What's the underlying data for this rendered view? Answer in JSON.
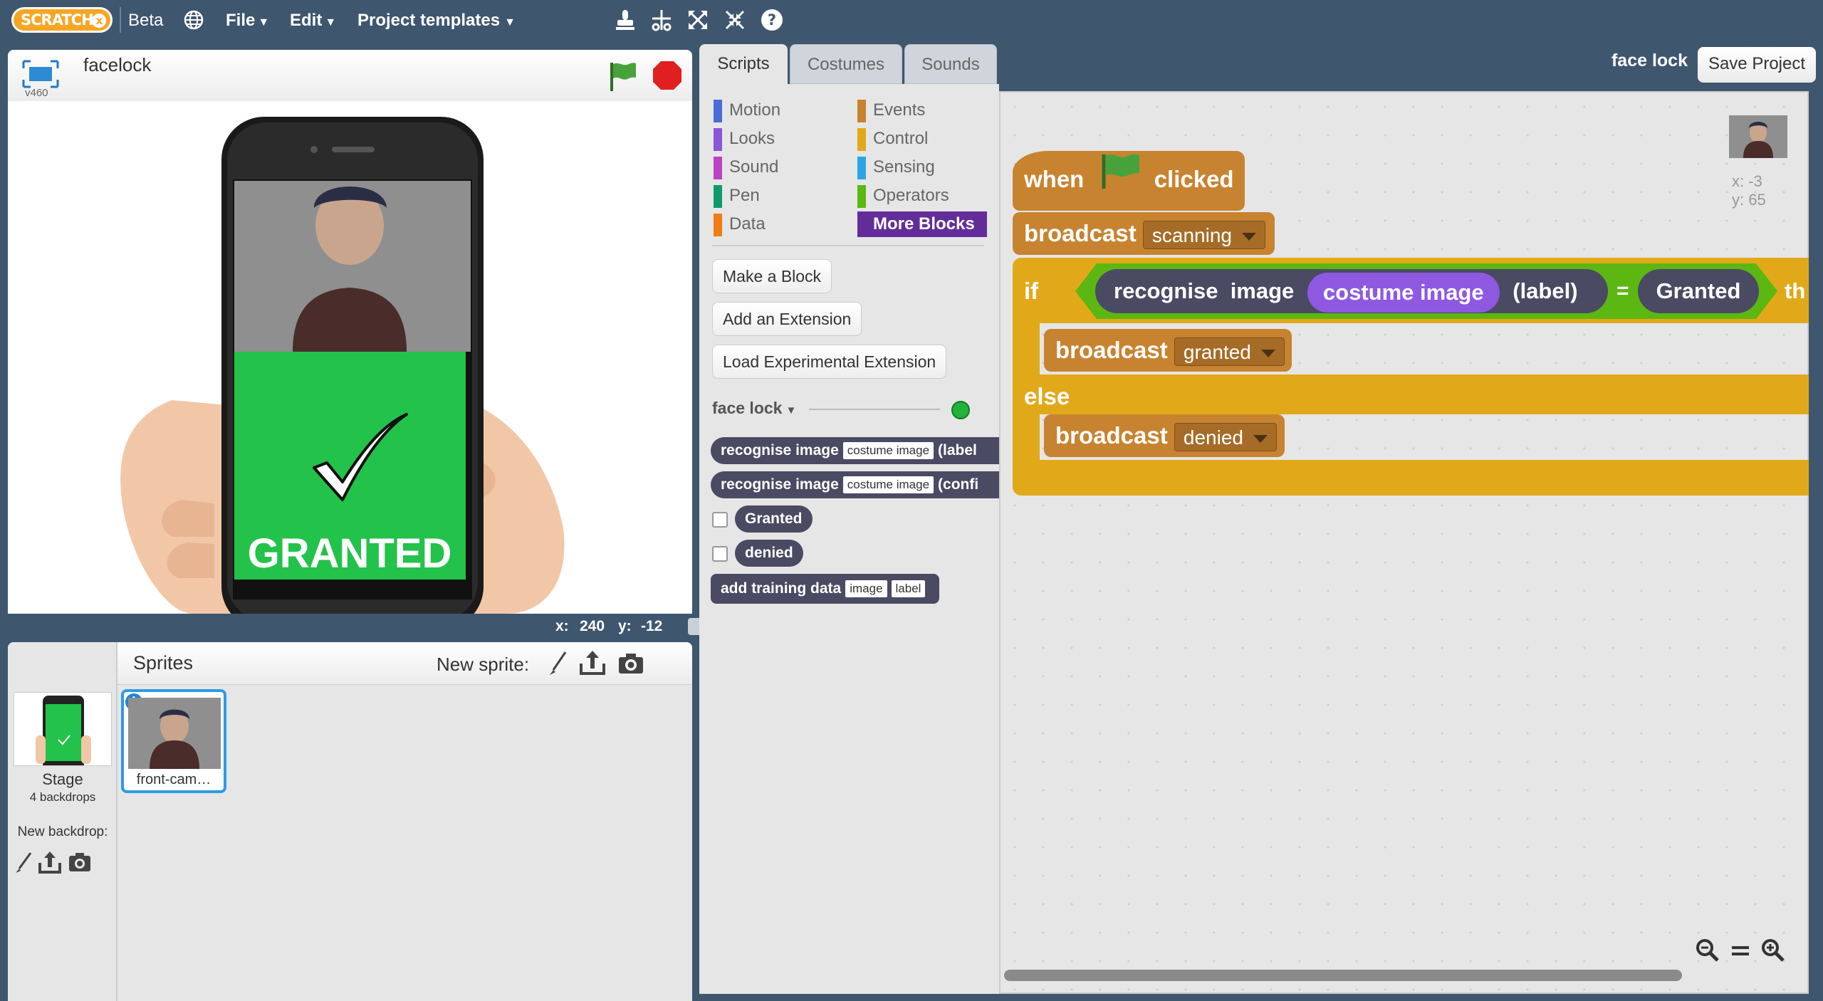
{
  "topbar": {
    "logo": "SCRATCH",
    "logo_x": "x",
    "beta": "Beta",
    "menu_file": "File",
    "menu_edit": "Edit",
    "menu_templates": "Project templates"
  },
  "stage": {
    "project_title": "facelock",
    "version": "v460",
    "screen_text": "GRANTED",
    "mouse_x_label": "x:",
    "mouse_x": "240",
    "mouse_y_label": "y:",
    "mouse_y": "-12"
  },
  "sprites": {
    "header": "Sprites",
    "new_sprite": "New sprite:",
    "stage_label": "Stage",
    "stage_backdrops": "4 backdrops",
    "new_backdrop": "New backdrop:",
    "sprite_name": "front-cam…"
  },
  "tabs": {
    "scripts": "Scripts",
    "costumes": "Costumes",
    "sounds": "Sounds"
  },
  "header_right": {
    "project_name": "face lock",
    "save": "Save Project"
  },
  "categories": {
    "motion": "Motion",
    "looks": "Looks",
    "sound": "Sound",
    "pen": "Pen",
    "data": "Data",
    "events": "Events",
    "control": "Control",
    "sensing": "Sensing",
    "operators": "Operators",
    "more_blocks": "More Blocks"
  },
  "palette": {
    "make_block": "Make a Block",
    "add_extension": "Add an Extension",
    "load_experimental": "Load Experimental Extension",
    "extension_name": "face lock",
    "recognise1_a": "recognise",
    "recognise1_b": "image",
    "recognise1_slot": "costume image",
    "recognise1_end": "(label",
    "recognise2_a": "recognise",
    "recognise2_b": "image",
    "recognise2_slot": "costume image",
    "recognise2_end": "(confi",
    "granted": "Granted",
    "denied": "denied",
    "add_training_a": "add",
    "add_training_b": "training",
    "add_training_c": "data",
    "add_training_slot1": "image",
    "add_training_slot2": "label"
  },
  "script": {
    "when": "when",
    "clicked": "clicked",
    "broadcast": "broadcast",
    "msg_scanning": "scanning",
    "if": "if",
    "recognise": "recognise",
    "image": "image",
    "costume_image": "costume image",
    "label": "(label)",
    "equals": "=",
    "granted_val": "Granted",
    "then": "th",
    "msg_granted": "granted",
    "else": "else",
    "msg_denied": "denied",
    "sprite_x": "x: -3",
    "sprite_y": "y: 65"
  },
  "colors": {
    "topbar": "#3f566f",
    "events": "#c88330",
    "control": "#e1a91a",
    "more_blocks": "#632d99",
    "reporter": "#4a4a63",
    "purple": "#8e59e0",
    "green_screen": "#23c24a"
  }
}
